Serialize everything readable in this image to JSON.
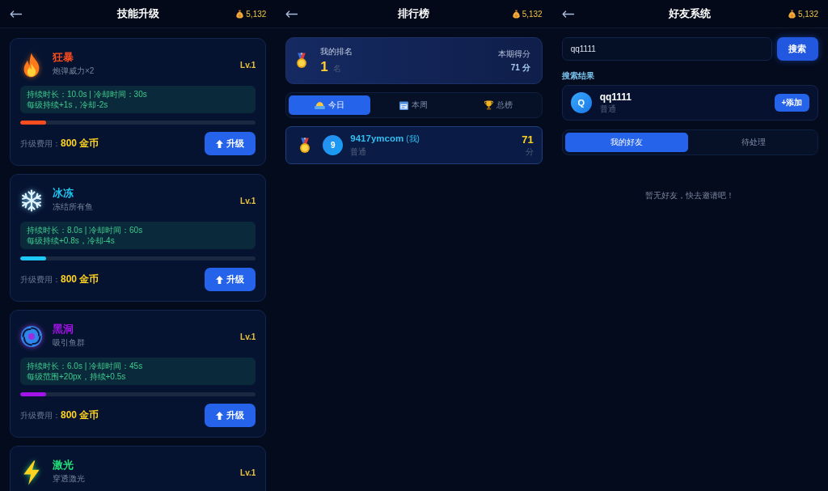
{
  "skill_upgrade": {
    "header": {
      "title": "技能升级",
      "coins": "5,132"
    },
    "skills": [
      {
        "kind": "fire",
        "name": "狂暴",
        "color": "#ff4d1f",
        "description": "炮弹威力×2",
        "level_label": "Lv.1",
        "stats": [
          "持续时长：10.0s | 冷却时间：30s",
          "每级持续+1s，冷却-2s"
        ],
        "level": 0.11,
        "cost_label": "升级费用：",
        "cost": "800 金币",
        "button": "升级"
      },
      {
        "kind": "ice",
        "name": "冰冻",
        "color": "#1ec8f5",
        "description": "冻结所有鱼",
        "level_label": "Lv.1",
        "stats": [
          "持续时长：8.0s | 冷却时间：60s",
          "每级持续+0.8s，冷却-4s"
        ],
        "level": 0.11,
        "cost_label": "升级费用：",
        "cost": "800 金币",
        "button": "升级"
      },
      {
        "kind": "vortex",
        "name": "黑洞",
        "color": "#a314e8",
        "description": "吸引鱼群",
        "level_label": "Lv.1",
        "stats": [
          "持续时长：6.0s | 冷却时间：45s",
          "每级范围+20px，持续+0.5s"
        ],
        "level": 0.11,
        "cost_label": "升级费用：",
        "cost": "800 金币",
        "button": "升级"
      },
      {
        "kind": "lightning",
        "name": "激光",
        "color": "#22e07a",
        "description": "穿透激光",
        "level_label": "Lv.1"
      }
    ]
  },
  "leaderboard": {
    "header": {
      "title": "排行榜",
      "coins": "5,132"
    },
    "my_rank": {
      "label": "我的排名",
      "rank": "1",
      "unit": "名",
      "score_label": "本期得分",
      "score": "71 分"
    },
    "tabs": [
      {
        "kind": "day",
        "label": "今日",
        "selected": true
      },
      {
        "kind": "week",
        "label": "本周",
        "selected": false
      },
      {
        "kind": "all",
        "label": "总榜",
        "selected": false
      }
    ],
    "entries": [
      {
        "avatar": "9",
        "name": "9417ymcom",
        "me_tag": "(我)",
        "tier": "普通",
        "score": "71",
        "unit": "分"
      }
    ]
  },
  "friends": {
    "header": {
      "title": "好友系统",
      "coins": "5,132"
    },
    "search": {
      "value": "qq1111",
      "button": "搜索"
    },
    "results_title": "搜索结果",
    "results": [
      {
        "avatar": "Q",
        "name": "qq1111",
        "tier": "普通",
        "button": "+添加"
      }
    ],
    "tabs": [
      {
        "label": "我的好友",
        "selected": true
      },
      {
        "label": "待处理",
        "selected": false
      }
    ],
    "empty_message": "暂无好友，快去邀请吧！"
  }
}
